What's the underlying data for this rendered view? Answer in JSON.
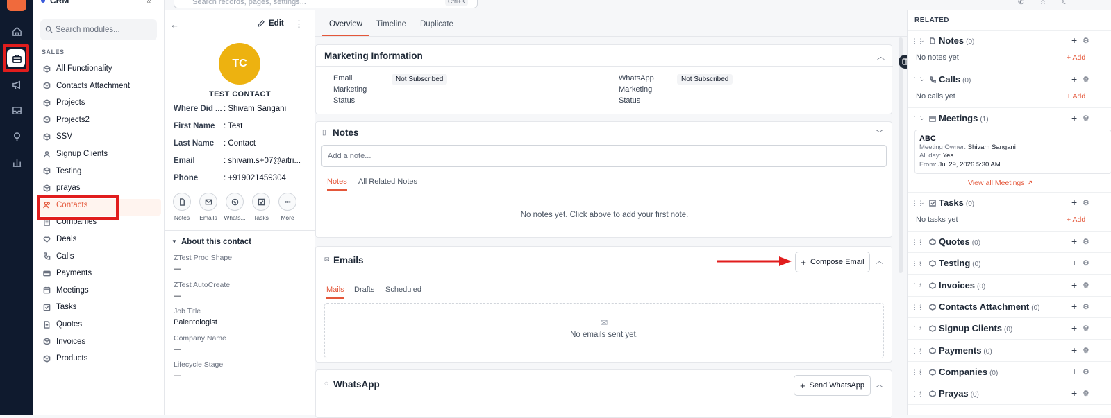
{
  "rail": {
    "icons": [
      "home-icon",
      "briefcase-icon",
      "megaphone-icon",
      "inbox-icon",
      "bulb-icon",
      "bar-chart-icon"
    ]
  },
  "module_nav": {
    "app_title": "CRM",
    "search_placeholder": "Search modules...",
    "section": "SALES",
    "items": [
      "All Functionality",
      "Contacts Attachment",
      "Projects",
      "Projects2",
      "SSV",
      "Signup Clients",
      "Testing",
      "prayas",
      "Contacts",
      "Companies",
      "Deals",
      "Calls",
      "Payments",
      "Meetings",
      "Tasks",
      "Quotes",
      "Invoices",
      "Products"
    ]
  },
  "topbar": {
    "search_placeholder": "Search records, pages, settings...",
    "shortcut": "Ctrl+K"
  },
  "contact": {
    "edit_label": "Edit",
    "initials": "TC",
    "name": "TEST CONTACT",
    "fields": [
      {
        "label": "Where Did ...",
        "value": ": Shivam Sangani"
      },
      {
        "label": "First Name",
        "value": ": Test"
      },
      {
        "label": "Last Name",
        "value": ": Contact"
      },
      {
        "label": "Email",
        "value": ": shivam.s+07@aitri..."
      },
      {
        "label": "Phone",
        "value": ": +919021459304"
      }
    ],
    "actions": [
      "Notes",
      "Emails",
      "Whats...",
      "Tasks",
      "More"
    ],
    "about_title": "About this contact",
    "about": [
      {
        "label": "ZTest Prod Shape",
        "value": "—"
      },
      {
        "label": "ZTest AutoCreate",
        "value": "—"
      },
      {
        "label": "Job Title",
        "value": "Palentologist"
      },
      {
        "label": "Company Name",
        "value": "—"
      },
      {
        "label": "Lifecycle Stage",
        "value": "—"
      }
    ]
  },
  "main": {
    "tabs": [
      "Overview",
      "Timeline",
      "Duplicate"
    ],
    "marketing": {
      "title": "Marketing Information",
      "email_label_1": "Email",
      "email_label_2": "Marketing",
      "email_label_3": "Status",
      "email_value": "Not Subscribed",
      "wa_label_1": "WhatsApp",
      "wa_label_2": "Marketing",
      "wa_label_3": "Status",
      "wa_value": "Not Subscribed"
    },
    "notes": {
      "title": "Notes",
      "placeholder": "Add a note...",
      "tabs": [
        "Notes",
        "All Related Notes"
      ],
      "empty": "No notes yet. Click above to add your first note."
    },
    "emails": {
      "title": "Emails",
      "compose": "Compose Email",
      "tabs": [
        "Mails",
        "Drafts",
        "Scheduled"
      ],
      "empty": "No emails sent yet."
    },
    "whatsapp": {
      "title": "WhatsApp",
      "send": "Send WhatsApp"
    }
  },
  "related": {
    "header": "RELATED",
    "notes": {
      "title": "Notes",
      "count": "(0)",
      "empty": "No notes yet",
      "add": "+ Add"
    },
    "calls": {
      "title": "Calls",
      "count": "(0)",
      "empty": "No calls yet",
      "add": "+ Add"
    },
    "meetings": {
      "title": "Meetings",
      "count": "(1)",
      "item": {
        "name": "ABC",
        "owner_label": "Meeting Owner:",
        "owner": "Shivam Sangani",
        "allday_label": "All day:",
        "allday": "Yes",
        "from_label": "From:",
        "from": "Jul 29, 2026 5:30 AM"
      },
      "view_all": "View all Meetings"
    },
    "tasks": {
      "title": "Tasks",
      "count": "(0)",
      "empty": "No tasks yet",
      "add": "+ Add"
    },
    "collapsed": [
      {
        "title": "Quotes",
        "count": "(0)"
      },
      {
        "title": "Testing",
        "count": "(0)"
      },
      {
        "title": "Invoices",
        "count": "(0)"
      },
      {
        "title": "Contacts Attachment",
        "count": "(0)"
      },
      {
        "title": "Signup Clients",
        "count": "(0)"
      },
      {
        "title": "Payments",
        "count": "(0)"
      },
      {
        "title": "Companies",
        "count": "(0)"
      },
      {
        "title": "Prayas",
        "count": "(0)"
      }
    ]
  },
  "colors": {
    "accent": "#e4573a",
    "highlight": "#e11d1d",
    "avatar": "#edb210",
    "rail": "#0f1a2e"
  }
}
